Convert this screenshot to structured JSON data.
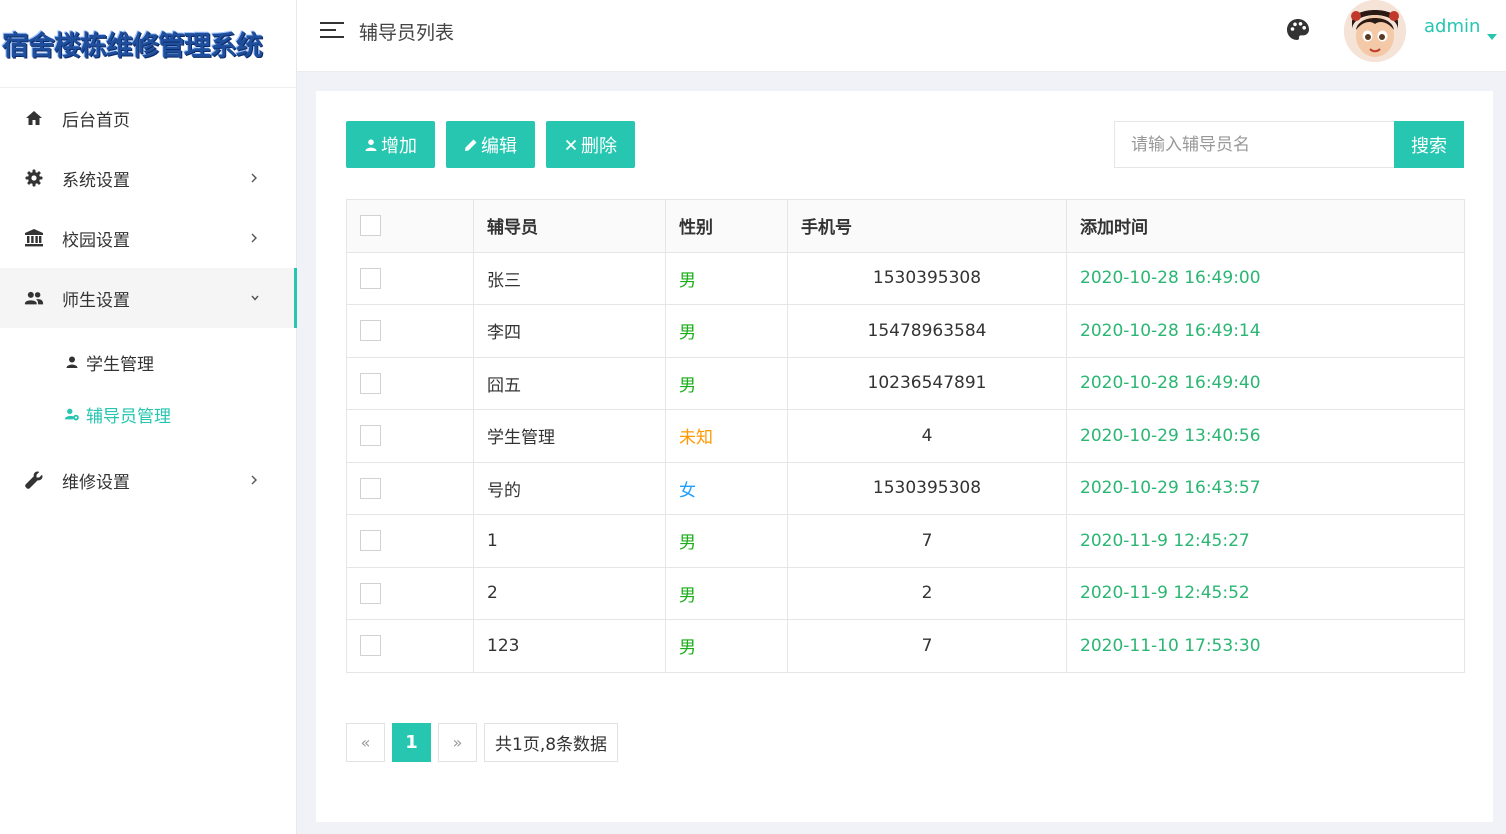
{
  "app": {
    "logo_text": "宿舍楼栋维修管理系统"
  },
  "colors": {
    "accent": "#26c6b0",
    "male": "#1aad19",
    "female": "#1e9fff",
    "unknown": "#ff9800",
    "time": "#2bb673"
  },
  "sidebar": {
    "items": [
      {
        "label": "后台首页",
        "icon": "home-icon",
        "has_arrow": false
      },
      {
        "label": "系统设置",
        "icon": "gear-icon",
        "has_arrow": true
      },
      {
        "label": "校园设置",
        "icon": "bank-icon",
        "has_arrow": true
      },
      {
        "label": "师生设置",
        "icon": "users-icon",
        "has_arrow": true,
        "open": true
      },
      {
        "label": "维修设置",
        "icon": "wrench-icon",
        "has_arrow": true
      }
    ],
    "submenu": [
      {
        "label": "学生管理",
        "icon": "user-icon",
        "active": false
      },
      {
        "label": "辅导员管理",
        "icon": "user-gear-icon",
        "active": true
      }
    ]
  },
  "header": {
    "title": "辅导员列表",
    "user_name": "admin"
  },
  "toolbar": {
    "add_label": "增加",
    "edit_label": "编辑",
    "delete_label": "删除",
    "search_placeholder": "请输入辅导员名",
    "search_label": "搜索"
  },
  "table": {
    "columns": [
      "辅导员",
      "性别",
      "手机号",
      "添加时间"
    ],
    "rows": [
      {
        "name": "张三",
        "gender": "男",
        "gender_type": "male",
        "phone": "1530395308",
        "time": "2020-10-28 16:49:00"
      },
      {
        "name": "李四",
        "gender": "男",
        "gender_type": "male",
        "phone": "15478963584",
        "time": "2020-10-28 16:49:14"
      },
      {
        "name": "囧五",
        "gender": "男",
        "gender_type": "male",
        "phone": "10236547891",
        "time": "2020-10-28 16:49:40"
      },
      {
        "name": "学生管理",
        "gender": "未知",
        "gender_type": "unknown",
        "phone": "4",
        "time": "2020-10-29 13:40:56"
      },
      {
        "name": "号的",
        "gender": "女",
        "gender_type": "female",
        "phone": "1530395308",
        "time": "2020-10-29 16:43:57"
      },
      {
        "name": "1",
        "gender": "男",
        "gender_type": "male",
        "phone": "7",
        "time": "2020-11-9 12:45:27"
      },
      {
        "name": "2",
        "gender": "男",
        "gender_type": "male",
        "phone": "2",
        "time": "2020-11-9 12:45:52"
      },
      {
        "name": "123",
        "gender": "男",
        "gender_type": "male",
        "phone": "7",
        "time": "2020-11-10 17:53:30"
      }
    ]
  },
  "pager": {
    "prev": "«",
    "current": "1",
    "next": "»",
    "info": "共1页,8条数据"
  }
}
